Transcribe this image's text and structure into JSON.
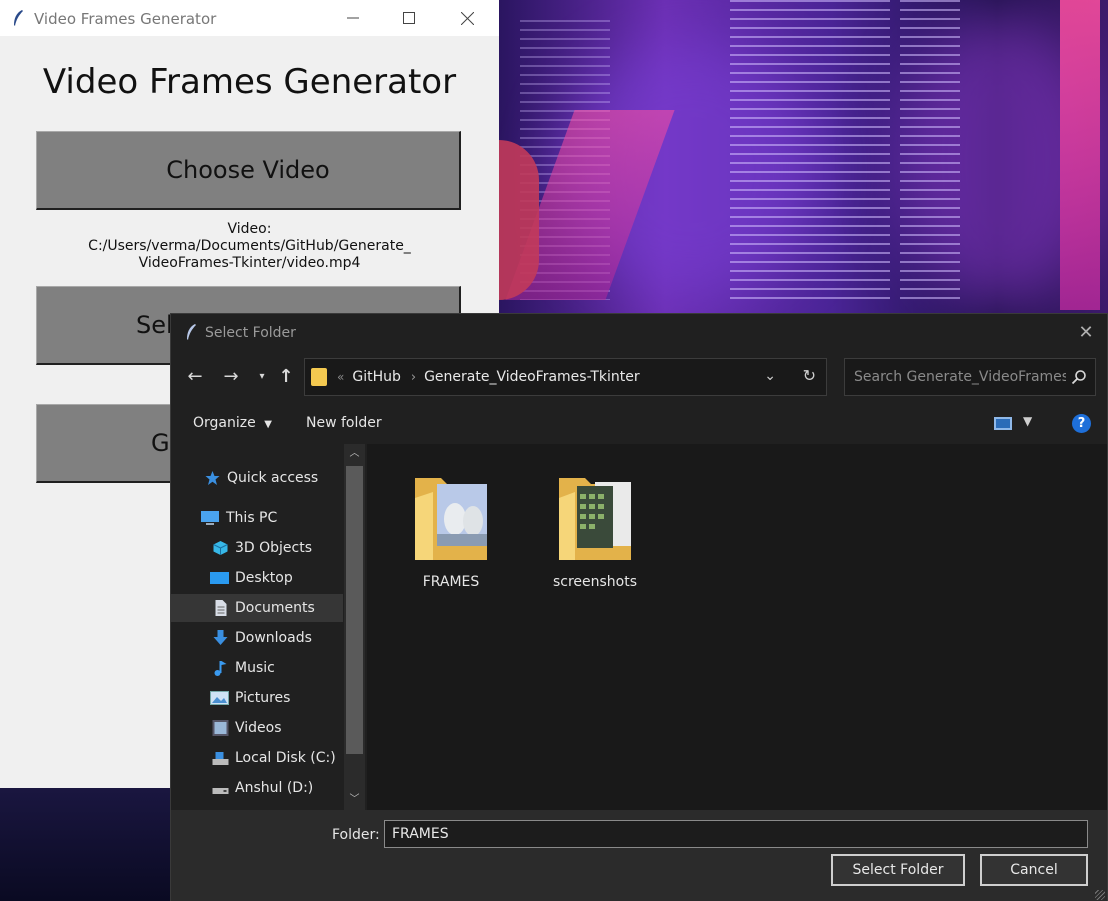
{
  "app": {
    "window_title": "Video Frames Generator",
    "heading": "Video Frames Generator",
    "choose_video_label": "Choose Video",
    "video_info_line1": "Video:",
    "video_info_line2": "C:/Users/verma/Documents/GitHub/Generate_",
    "video_info_line3": "VideoFrames-Tkinter/video.mp4",
    "select_folder_label_visible": "Sel",
    "generate_label_visible": "G"
  },
  "dialog": {
    "title": "Select Folder",
    "breadcrumb": [
      "GitHub",
      "Generate_VideoFrames-Tkinter"
    ],
    "search_placeholder": "Search Generate_VideoFrames-Tkinter",
    "toolbar": {
      "organize": "Organize",
      "new_folder": "New folder"
    },
    "nav_items": [
      {
        "label": "Quick access",
        "icon": "star-icon"
      },
      {
        "label": "This PC",
        "icon": "computer-icon"
      },
      {
        "label": "3D Objects",
        "icon": "cube-icon"
      },
      {
        "label": "Desktop",
        "icon": "desktop-icon"
      },
      {
        "label": "Documents",
        "icon": "document-icon"
      },
      {
        "label": "Downloads",
        "icon": "download-icon"
      },
      {
        "label": "Music",
        "icon": "music-icon"
      },
      {
        "label": "Pictures",
        "icon": "pictures-icon"
      },
      {
        "label": "Videos",
        "icon": "videos-icon"
      },
      {
        "label": "Local Disk (C:)",
        "icon": "drive-icon"
      },
      {
        "label": "Anshul (D:)",
        "icon": "drive-icon"
      }
    ],
    "selected_nav": "Documents",
    "folders": [
      {
        "name": "FRAMES"
      },
      {
        "name": "screenshots"
      }
    ],
    "folder_label": "Folder:",
    "folder_value": "FRAMES",
    "select_button": "Select Folder",
    "cancel_button": "Cancel"
  },
  "colors": {
    "accent": "#1e6fd9",
    "folder": "#f4c950",
    "dialog_bg": "#202020",
    "tk_bg": "#f0f0f0",
    "tk_button": "#808080"
  }
}
